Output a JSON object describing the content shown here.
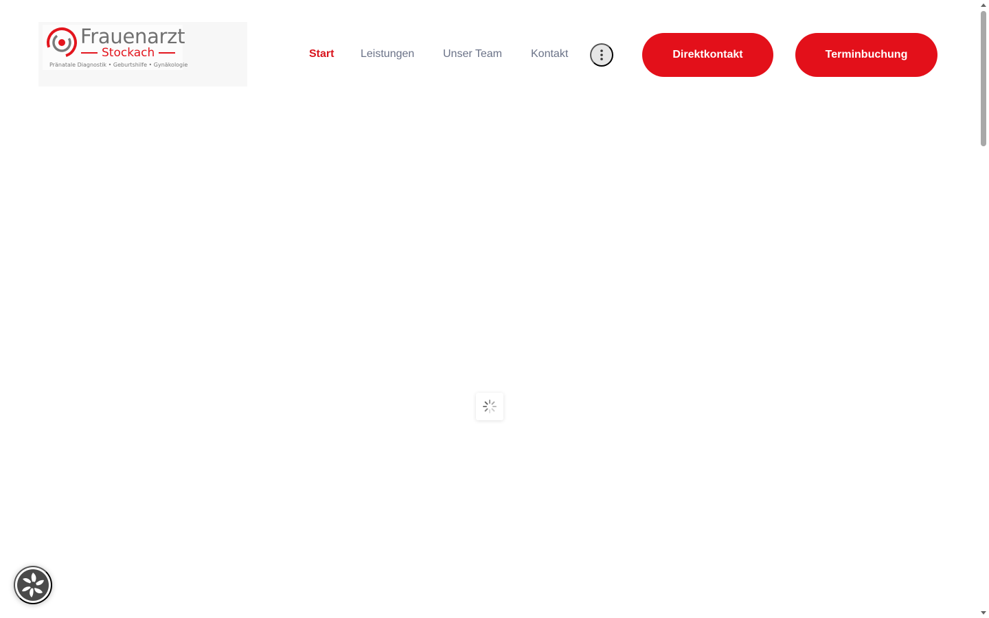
{
  "logo": {
    "title": "Frauenarzt",
    "subtitle": "Stockach",
    "tagline": "Pränatale Diagnostik • Geburtshilfe • Gynäkologie"
  },
  "nav": {
    "items": [
      {
        "label": "Start",
        "active": true
      },
      {
        "label": "Leistungen",
        "active": false
      },
      {
        "label": "Unser Team",
        "active": false
      },
      {
        "label": "Kontakt",
        "active": false
      }
    ],
    "more_icon": "more-vertical-icon"
  },
  "cta": {
    "direktkontakt": "Direktkontakt",
    "terminbuchung": "Terminbuchung"
  },
  "colors": {
    "brand_red": "#e3101a",
    "nav_text": "#6a7287",
    "logo_gray": "#707070"
  },
  "icons": {
    "loader": "loading-spinner-icon",
    "consent": "cookie-consent-icon"
  }
}
